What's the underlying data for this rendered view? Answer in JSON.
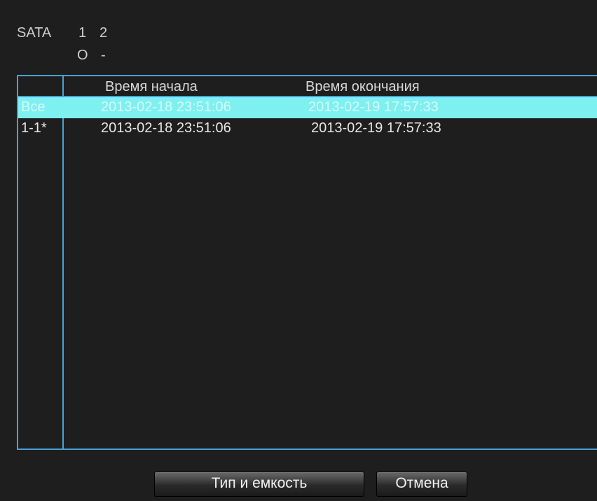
{
  "sata": {
    "label": "SATA",
    "disks": [
      {
        "number": "1",
        "status": "O"
      },
      {
        "number": "2",
        "status": "-"
      }
    ]
  },
  "table": {
    "columns": [
      "",
      "Время начала",
      "Время окончания"
    ],
    "rows": [
      {
        "id": "Все",
        "start": "2013-02-18 23:51:06",
        "end": "2013-02-19 17:57:33",
        "selected": true
      },
      {
        "id": "1-1*",
        "start": "2013-02-18 23:51:06",
        "end": "2013-02-19 17:57:33",
        "selected": false
      }
    ]
  },
  "buttons": {
    "type_capacity": "Тип и емкость",
    "cancel": "Отмена"
  },
  "colors": {
    "border": "#4aa0d8",
    "selection": "#7ff0f0",
    "background": "#1e1e1e"
  }
}
